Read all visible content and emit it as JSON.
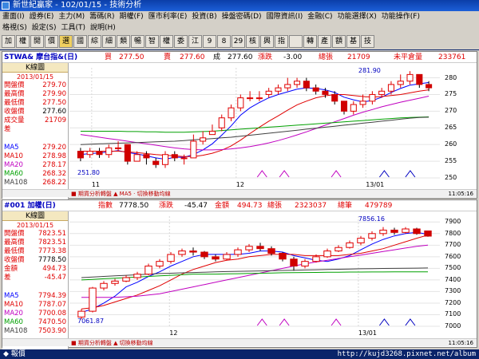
{
  "window": {
    "title": "新世紀贏家 - 102/01/15 - 技術分析"
  },
  "menu": {
    "row1": [
      "畫面(I)",
      "證券(E)",
      "主力(M)",
      "籌碼(R)",
      "期權(F)",
      "匯市利率(E)",
      "投資(B)",
      "操盤密碼(D)",
      "國際資訊(I)",
      "金融(C)",
      "功能選擇(X)",
      "功能操作(F)"
    ],
    "row2": [
      "格視(S)",
      "設定(S)",
      "工具(T)",
      "說明(H)"
    ]
  },
  "toolbar": [
    "加",
    "權",
    "開",
    "價",
    "選",
    "國",
    "綜",
    "細",
    "類",
    "暢",
    "智",
    "權",
    "委",
    "江",
    "9",
    "8",
    "29",
    "核",
    "興",
    "指",
    "",
    "轉",
    "產",
    "額",
    "基",
    "技"
  ],
  "chart1": {
    "header": {
      "symbol": "STWA& 摩台指&(日)",
      "buy_label": "買",
      "buy": "277.50",
      "sell_label": "賣",
      "sell": "277.60",
      "deal_label": "成",
      "deal": "277.60",
      "chg_label": "漲跌",
      "chg": "-3.00",
      "vol_label": "總張",
      "vol": "21709",
      "oi_label": "未平倉量",
      "oi": "233761"
    },
    "info": {
      "title": "K線圖",
      "date": "2013/01/15",
      "rows": [
        [
          "開盤價",
          "279.70"
        ],
        [
          "最高價",
          "279.90"
        ],
        [
          "最低價",
          "277.50"
        ],
        [
          "收盤價",
          "277.60"
        ],
        [
          "成交量",
          "21709"
        ],
        [
          "差",
          ""
        ]
      ],
      "ma": [
        [
          "MA5",
          "279.20"
        ],
        [
          "MA10",
          "278.98"
        ],
        [
          "MA20",
          "278.17"
        ],
        [
          "MA60",
          "268.32"
        ],
        [
          "MA108",
          "268.22"
        ]
      ]
    },
    "yticks": [
      "280",
      "275",
      "270",
      "265",
      "260",
      "255",
      "250"
    ],
    "xticks": [
      "11",
      "12",
      "13/01"
    ],
    "high_label": "281.90",
    "low_label": "251.80",
    "footer": "■ 期貨分析轉盤 ▲ MA5 · 切換移動均線",
    "time": "11:05:16"
  },
  "chart2": {
    "header": {
      "symbol": "#001 加權(日)",
      "idx_label": "指數",
      "idx": "7778.50",
      "chg_label": "漲跌",
      "chg": "-45.47",
      "amt_label": "金額",
      "amt": "494.73",
      "vol_label": "總張",
      "vol": "2323037",
      "tot_label": "總筆",
      "tot": "479789"
    },
    "info": {
      "title": "K線圖",
      "date": "2013/01/15",
      "rows": [
        [
          "開盤價",
          "7823.51"
        ],
        [
          "最高價",
          "7823.51"
        ],
        [
          "最低價",
          "7773.38"
        ],
        [
          "收盤價",
          "7778.50"
        ],
        [
          "金額",
          "494.73"
        ],
        [
          "差",
          "-45.47"
        ]
      ],
      "ma": [
        [
          "MA5",
          "7794.39"
        ],
        [
          "MA10",
          "7787.07"
        ],
        [
          "MA20",
          "7700.08"
        ],
        [
          "MA60",
          "7470.50"
        ],
        [
          "MA108",
          "7503.90"
        ]
      ]
    },
    "yticks": [
      "7900",
      "7800",
      "7700",
      "7600",
      "7500",
      "7400",
      "7300",
      "7200",
      "7100",
      "7000"
    ],
    "xticks": [
      "12",
      "13/01"
    ],
    "high_label": "7856.16",
    "low_label": "7061.87",
    "footer": "■ 期貨分析轉盤 ▲ 切換移動均線",
    "time": "11:05:16"
  },
  "statusbar": {
    "left": "◆ 報價",
    "url": "http://kujd3268.pixnet.net/album"
  },
  "chart_data": [
    {
      "type": "candlestick",
      "title": "STWA& 摩台指&(日)",
      "ylim": [
        250,
        283
      ],
      "candles": [
        [
          258,
          256,
          259,
          255
        ],
        [
          257,
          258,
          259,
          256
        ],
        [
          258,
          257,
          259,
          256
        ],
        [
          257,
          259,
          260,
          256
        ],
        [
          259,
          259,
          261,
          258
        ],
        [
          260,
          255,
          260,
          254
        ],
        [
          255,
          257,
          258,
          255
        ],
        [
          257,
          256,
          258,
          254
        ],
        [
          255,
          254,
          256,
          253
        ],
        [
          254,
          257,
          258,
          253
        ],
        [
          257,
          256,
          258,
          255
        ],
        [
          256,
          256,
          257,
          254
        ],
        [
          256,
          261,
          263,
          256
        ],
        [
          261,
          262,
          264,
          260
        ],
        [
          263,
          264,
          266,
          263
        ],
        [
          265,
          268,
          269,
          264
        ],
        [
          268,
          271,
          272,
          267
        ],
        [
          271,
          274,
          275,
          270
        ],
        [
          274,
          274,
          276,
          273
        ],
        [
          274,
          274,
          276,
          273
        ],
        [
          275,
          276,
          277,
          274
        ],
        [
          276,
          277,
          278,
          275
        ],
        [
          277,
          278,
          280,
          276
        ],
        [
          278,
          279,
          280,
          277
        ],
        [
          279,
          277,
          280,
          276
        ],
        [
          277,
          276,
          278,
          275
        ],
        [
          276,
          275,
          277,
          274
        ],
        [
          275,
          273,
          276,
          272
        ],
        [
          273,
          270,
          273,
          269
        ],
        [
          270,
          272,
          273,
          269
        ],
        [
          272,
          273,
          275,
          271
        ],
        [
          273,
          275,
          276,
          272
        ],
        [
          275,
          276,
          277,
          274
        ],
        [
          276,
          278,
          279,
          275
        ],
        [
          278,
          279,
          281,
          277
        ],
        [
          279,
          281,
          282,
          278
        ],
        [
          281,
          278,
          281,
          277
        ],
        [
          278,
          277,
          279,
          276
        ]
      ],
      "series": [
        {
          "name": "MA5",
          "color": "#0000ff",
          "values": [
            257,
            257.3,
            257.5,
            257.8,
            258.2,
            257.6,
            257.2,
            256.6,
            256,
            255.6,
            256.2,
            256.2,
            257,
            258.4,
            260.2,
            262.8,
            265.6,
            268.8,
            271,
            272.6,
            274,
            275,
            275.8,
            276.6,
            277,
            276.8,
            276.4,
            275.6,
            274.2,
            273.4,
            272.8,
            273.2,
            274.2,
            275.6,
            276.8,
            277.8,
            278.2,
            278.6
          ]
        },
        {
          "name": "MA10",
          "color": "#e00000",
          "values": [
            258,
            258,
            258,
            258,
            258,
            257.8,
            257.6,
            257.3,
            257,
            256.8,
            256.6,
            256.4,
            256.4,
            256.8,
            257.4,
            258.3,
            259.6,
            261.3,
            263.3,
            265.2,
            267,
            268.6,
            270.3,
            271.9,
            273,
            274,
            274.6,
            275,
            275,
            274.7,
            274.4,
            274.2,
            274.4,
            274.7,
            275,
            275.5,
            276,
            276.4
          ]
        },
        {
          "name": "MA20",
          "color": "#c000c0",
          "values": [
            263,
            262.6,
            262.2,
            261.8,
            261.4,
            261,
            260.6,
            260.2,
            259.8,
            259.4,
            259,
            258.7,
            258.5,
            258.4,
            258.4,
            258.5,
            258.7,
            259,
            259.4,
            259.9,
            260.5,
            261.2,
            262,
            262.9,
            263.8,
            264.8,
            265.8,
            266.8,
            267.8,
            268.8,
            269.7,
            270.5,
            271.3,
            272,
            272.7,
            273.3,
            273.9,
            274.5
          ]
        },
        {
          "name": "MA60",
          "color": "#00a000",
          "values": [
            264,
            264,
            264,
            264,
            264,
            263.9,
            263.9,
            263.8,
            263.8,
            263.7,
            263.7,
            263.7,
            263.8,
            263.9,
            264,
            264.2,
            264.4,
            264.6,
            264.8,
            265,
            265.2,
            265.4,
            265.6,
            265.8,
            266,
            266.2,
            266.4,
            266.6,
            266.8,
            267,
            267.2,
            267.4,
            267.6,
            267.8,
            268,
            268.1,
            268.2,
            268.3
          ]
        },
        {
          "name": "MA108",
          "color": "#404040",
          "values": [
            260,
            260.1,
            260.2,
            260.3,
            260.4,
            260.5,
            260.6,
            260.7,
            260.8,
            260.9,
            261,
            261.2,
            261.4,
            261.6,
            261.8,
            262,
            262.2,
            262.5,
            262.8,
            263.1,
            263.4,
            263.7,
            264,
            264.3,
            264.6,
            264.9,
            265.2,
            265.5,
            265.8,
            266.1,
            266.4,
            266.7,
            267,
            267.3,
            267.6,
            267.9,
            268.1,
            268.2
          ]
        }
      ]
    },
    {
      "type": "candlestick",
      "title": "#001 加權(日)",
      "ylim": [
        7000,
        7950
      ],
      "candles": [
        [
          7080,
          7130,
          7150,
          7060
        ],
        [
          7130,
          7330,
          7340,
          7120
        ],
        [
          7330,
          7370,
          7390,
          7310
        ],
        [
          7370,
          7390,
          7410,
          7350
        ],
        [
          7390,
          7420,
          7440,
          7380
        ],
        [
          7420,
          7450,
          7470,
          7400
        ],
        [
          7450,
          7520,
          7540,
          7440
        ],
        [
          7520,
          7560,
          7580,
          7500
        ],
        [
          7560,
          7620,
          7640,
          7540
        ],
        [
          7620,
          7650,
          7670,
          7600
        ],
        [
          7650,
          7640,
          7680,
          7610
        ],
        [
          7640,
          7600,
          7650,
          7580
        ],
        [
          7600,
          7580,
          7620,
          7560
        ],
        [
          7580,
          7620,
          7640,
          7570
        ],
        [
          7620,
          7660,
          7680,
          7600
        ],
        [
          7660,
          7690,
          7710,
          7640
        ],
        [
          7690,
          7670,
          7720,
          7650
        ],
        [
          7670,
          7630,
          7690,
          7610
        ],
        [
          7630,
          7580,
          7640,
          7560
        ],
        [
          7580,
          7520,
          7600,
          7480
        ],
        [
          7520,
          7560,
          7580,
          7500
        ],
        [
          7560,
          7600,
          7620,
          7550
        ],
        [
          7600,
          7650,
          7670,
          7590
        ],
        [
          7650,
          7680,
          7700,
          7640
        ],
        [
          7680,
          7720,
          7740,
          7670
        ],
        [
          7720,
          7760,
          7780,
          7700
        ],
        [
          7760,
          7800,
          7820,
          7740
        ],
        [
          7800,
          7830,
          7856,
          7780
        ],
        [
          7830,
          7810,
          7850,
          7790
        ],
        [
          7810,
          7840,
          7856,
          7800
        ],
        [
          7840,
          7800,
          7850,
          7790
        ],
        [
          7823,
          7778,
          7823,
          7773
        ]
      ],
      "series": [
        {
          "name": "MA5",
          "color": "#0000ff",
          "values": [
            7120,
            7150,
            7200,
            7260,
            7340,
            7380,
            7430,
            7470,
            7520,
            7560,
            7600,
            7620,
            7620,
            7620,
            7620,
            7630,
            7650,
            7650,
            7640,
            7610,
            7590,
            7570,
            7560,
            7580,
            7610,
            7660,
            7710,
            7750,
            7780,
            7800,
            7810,
            7794
          ]
        },
        {
          "name": "MA10",
          "color": "#e00000",
          "values": [
            7150,
            7160,
            7180,
            7210,
            7240,
            7270,
            7310,
            7350,
            7400,
            7450,
            7490,
            7520,
            7550,
            7570,
            7580,
            7600,
            7610,
            7620,
            7620,
            7620,
            7610,
            7610,
            7610,
            7610,
            7620,
            7630,
            7650,
            7670,
            7700,
            7730,
            7760,
            7787
          ]
        },
        {
          "name": "MA20",
          "color": "#c000c0",
          "values": [
            7250,
            7250,
            7250,
            7250,
            7255,
            7260,
            7270,
            7280,
            7300,
            7320,
            7340,
            7360,
            7380,
            7400,
            7420,
            7440,
            7460,
            7480,
            7500,
            7520,
            7540,
            7555,
            7570,
            7585,
            7600,
            7615,
            7630,
            7645,
            7660,
            7675,
            7690,
            7700
          ]
        },
        {
          "name": "MA60",
          "color": "#00a000",
          "values": [
            7400,
            7405,
            7410,
            7415,
            7420,
            7425,
            7430,
            7435,
            7440,
            7445,
            7450,
            7450,
            7450,
            7452,
            7454,
            7456,
            7458,
            7460,
            7462,
            7463,
            7464,
            7465,
            7466,
            7467,
            7468,
            7468,
            7469,
            7469,
            7470,
            7470,
            7470,
            7470
          ]
        },
        {
          "name": "MA108",
          "color": "#404040",
          "values": [
            7420,
            7425,
            7430,
            7435,
            7440,
            7445,
            7450,
            7455,
            7458,
            7461,
            7464,
            7467,
            7470,
            7472,
            7474,
            7476,
            7478,
            7480,
            7482,
            7484,
            7486,
            7488,
            7490,
            7492,
            7494,
            7496,
            7498,
            7499,
            7500,
            7501,
            7502,
            7503
          ]
        }
      ]
    }
  ]
}
